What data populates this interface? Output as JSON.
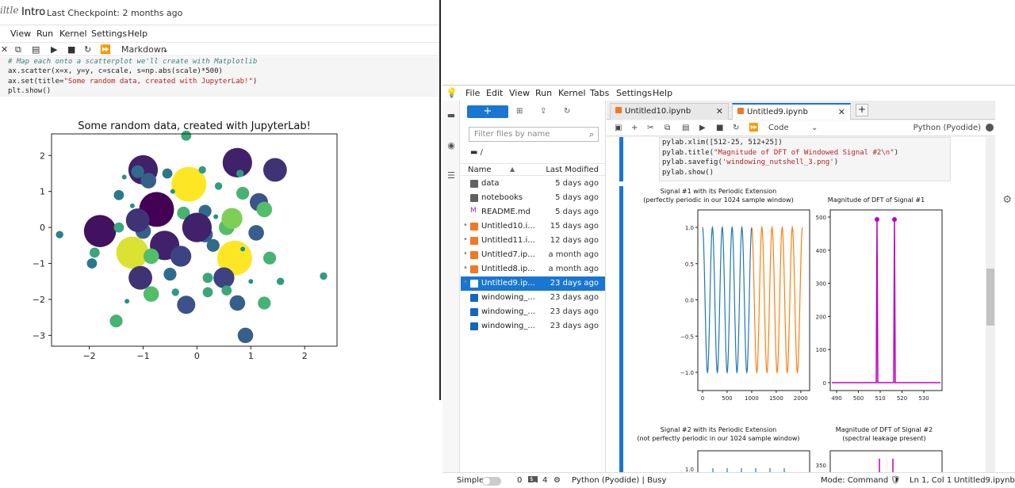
{
  "left_window": {
    "logo": "iltle",
    "notebook_name": "Intro",
    "checkpoint": "Last Checkpoint: 2 months ago",
    "menu": [
      "View",
      "Run",
      "Kernel",
      "Settings",
      "Help"
    ],
    "toolbar": {
      "cell_type": "Markdown"
    },
    "code_lines": {
      "l1": "# Map each onto a scatterplot we'll create with Matplotlib",
      "l2": "ax.scatter(x=x, y=y, c=scale, s=np.abs(scale)*500)",
      "l3a": "ax.set(title=",
      "l3b": "\"Some random data, created with JupyterLab!\"",
      "l3c": ")",
      "l4": "plt.show()"
    },
    "chart_data": {
      "type": "scatter",
      "title": "Some random data, created with JupyterLab!",
      "xlim": [
        -2.7,
        2.6
      ],
      "ylim": [
        -3.3,
        2.6
      ],
      "xticks": [
        -2,
        -1,
        0,
        1,
        2
      ],
      "yticks": [
        -3,
        -2,
        -1,
        0,
        1,
        2
      ],
      "xtick_labels": [
        "−2",
        "−1",
        "0",
        "1",
        "2"
      ],
      "ytick_labels": [
        "−3",
        "−2",
        "−1",
        "0",
        "1",
        "2"
      ],
      "points": [
        {
          "x": -0.2,
          "y": 2.55,
          "c": 0.6
        },
        {
          "x": -1.0,
          "y": 1.6,
          "c": 0.1
        },
        {
          "x": -1.1,
          "y": 1.55,
          "c": 0.35
        },
        {
          "x": -1.35,
          "y": 1.4,
          "c": 0.5
        },
        {
          "x": -0.9,
          "y": 1.3,
          "c": 0.3
        },
        {
          "x": -0.55,
          "y": 1.5,
          "c": 0.4
        },
        {
          "x": -0.15,
          "y": 1.2,
          "c": 1.0
        },
        {
          "x": 0.1,
          "y": 1.6,
          "c": 0.55
        },
        {
          "x": 0.4,
          "y": 1.15,
          "c": 0.55
        },
        {
          "x": 0.75,
          "y": 1.8,
          "c": 0.1
        },
        {
          "x": 0.8,
          "y": 1.5,
          "c": 0.55
        },
        {
          "x": 0.85,
          "y": 0.95,
          "c": 0.65
        },
        {
          "x": 1.45,
          "y": 1.6,
          "c": 0.15
        },
        {
          "x": 1.15,
          "y": 0.7,
          "c": 0.25
        },
        {
          "x": 1.25,
          "y": 0.5,
          "c": 0.7
        },
        {
          "x": -1.45,
          "y": 0.9,
          "c": 0.4
        },
        {
          "x": -1.2,
          "y": 0.6,
          "c": 0.5
        },
        {
          "x": -0.75,
          "y": 0.5,
          "c": 0.0
        },
        {
          "x": -0.45,
          "y": 1.0,
          "c": 0.5
        },
        {
          "x": -0.25,
          "y": 0.4,
          "c": 0.65
        },
        {
          "x": 0.15,
          "y": 0.45,
          "c": 0.35
        },
        {
          "x": 0.35,
          "y": 0.3,
          "c": 0.5
        },
        {
          "x": 0.55,
          "y": 0.0,
          "c": 0.7
        },
        {
          "x": 0.65,
          "y": 0.25,
          "c": 0.8
        },
        {
          "x": -1.8,
          "y": -0.1,
          "c": 0.05
        },
        {
          "x": -1.45,
          "y": 0.0,
          "c": 0.6
        },
        {
          "x": -1.0,
          "y": -0.1,
          "c": 0.3
        },
        {
          "x": -0.6,
          "y": -0.5,
          "c": 0.1
        },
        {
          "x": -1.2,
          "y": -0.7,
          "c": 0.95
        },
        {
          "x": -0.85,
          "y": -0.8,
          "c": 0.7
        },
        {
          "x": -0.3,
          "y": -0.8,
          "c": 0.2
        },
        {
          "x": 0.15,
          "y": -0.2,
          "c": 0.3
        },
        {
          "x": 0.3,
          "y": -0.5,
          "c": 0.35
        },
        {
          "x": 0.7,
          "y": -0.85,
          "c": 1.0
        },
        {
          "x": 0.85,
          "y": -0.6,
          "c": 0.5
        },
        {
          "x": 1.1,
          "y": -0.15,
          "c": 0.3
        },
        {
          "x": 1.35,
          "y": -0.85,
          "c": 0.65
        },
        {
          "x": -1.9,
          "y": -0.7,
          "c": 0.6
        },
        {
          "x": -2.55,
          "y": -0.2,
          "c": 0.45
        },
        {
          "x": -1.05,
          "y": -1.4,
          "c": 0.15
        },
        {
          "x": -0.85,
          "y": -1.85,
          "c": 0.7
        },
        {
          "x": -0.4,
          "y": -1.8,
          "c": 0.55
        },
        {
          "x": 0.2,
          "y": -1.4,
          "c": 0.6
        },
        {
          "x": 0.5,
          "y": -1.4,
          "c": 0.2
        },
        {
          "x": 0.55,
          "y": -1.75,
          "c": 0.6
        },
        {
          "x": 0.2,
          "y": -1.8,
          "c": 0.6
        },
        {
          "x": -0.2,
          "y": -2.15,
          "c": 0.25
        },
        {
          "x": 0.75,
          "y": -2.1,
          "c": 0.3
        },
        {
          "x": 1.25,
          "y": -2.1,
          "c": 0.65
        },
        {
          "x": -1.3,
          "y": -2.05,
          "c": 0.5
        },
        {
          "x": -1.5,
          "y": -2.6,
          "c": 0.65
        },
        {
          "x": 0.9,
          "y": -3.0,
          "c": 0.3
        },
        {
          "x": 2.35,
          "y": -1.35,
          "c": 0.55
        },
        {
          "x": 1.55,
          "y": -1.5,
          "c": 0.55
        },
        {
          "x": -1.95,
          "y": -1.0,
          "c": 0.4
        },
        {
          "x": -0.5,
          "y": -1.3,
          "c": 0.35
        },
        {
          "x": 1.0,
          "y": -1.5,
          "c": 0.5
        },
        {
          "x": -1.1,
          "y": 0.2,
          "c": 0.15
        },
        {
          "x": 0.0,
          "y": 0.0,
          "c": 0.1
        }
      ]
    }
  },
  "right_window": {
    "menu": [
      "File",
      "Edit",
      "View",
      "Run",
      "Kernel",
      "Tabs",
      "Settings",
      "Help"
    ],
    "file_browser": {
      "new_label": "+",
      "filter_placeholder": "Filter files by name",
      "breadcrumb": "/",
      "col_name": "Name",
      "col_modified": "Last Modified",
      "files": [
        {
          "name": "data",
          "modified": "5 days ago",
          "kind": "folder",
          "running": false,
          "selected": false
        },
        {
          "name": "notebooks",
          "modified": "5 days ago",
          "kind": "folder",
          "running": false,
          "selected": false
        },
        {
          "name": "README.md",
          "modified": "5 days ago",
          "kind": "markdown",
          "running": false,
          "selected": false
        },
        {
          "name": "Untitled10.i...",
          "modified": "15 days ago",
          "kind": "notebook",
          "running": true,
          "selected": false
        },
        {
          "name": "Untitled11.i...",
          "modified": "12 days ago",
          "kind": "notebook",
          "running": true,
          "selected": false
        },
        {
          "name": "Untitled7.ip...",
          "modified": "a month ago",
          "kind": "notebook",
          "running": true,
          "selected": false
        },
        {
          "name": "Untitled8.ip...",
          "modified": "a month ago",
          "kind": "notebook",
          "running": true,
          "selected": false
        },
        {
          "name": "Untitled9.ip...",
          "modified": "23 days ago",
          "kind": "notebook",
          "running": true,
          "selected": true
        },
        {
          "name": "windowing_...",
          "modified": "23 days ago",
          "kind": "image",
          "running": false,
          "selected": false
        },
        {
          "name": "windowing_...",
          "modified": "23 days ago",
          "kind": "image",
          "running": false,
          "selected": false
        },
        {
          "name": "windowing_...",
          "modified": "23 days ago",
          "kind": "image",
          "running": false,
          "selected": false
        }
      ]
    },
    "tabs": [
      {
        "label": "Untitled10.ipynb",
        "active": false
      },
      {
        "label": "Untitled9.ipynb",
        "active": true
      }
    ],
    "toolbar": {
      "cell_type": "Code",
      "kernel": "Python (Pyodide)"
    },
    "code": {
      "l1": "pylab.xlim([512-25, 512+25])",
      "l2a": "pylab.title(",
      "l2b": "\"Magnitude of DFT of Windowed Signal #2\\n\"",
      "l2c": ")",
      "l3a": "pylab.savefig(",
      "l3b": "'windowing_nutshell_3.png'",
      "l3c": ")",
      "l4": "pylab.show()"
    },
    "fig1": {
      "left_title_1": "Signal #1 with its Periodic Extension",
      "left_title_2": "(perfectly periodic in our 1024 sample window)",
      "right_title": "Magnitude of DFT of Signal #1",
      "left_yticks": [
        "1.0",
        "0.5",
        "0.0",
        "−0.5",
        "−1.0"
      ],
      "left_xticks": [
        "0",
        "500",
        "1000",
        "1500",
        "2000"
      ],
      "right_yticks": [
        "500",
        "400",
        "300",
        "200",
        "100",
        "0"
      ],
      "right_xticks": [
        "490",
        "500",
        "510",
        "520",
        "530"
      ],
      "signal_color_1": "#1f77b4",
      "signal_color_2": "#ff7f0e",
      "dft_color": "#bf00bf"
    },
    "fig2": {
      "left_title_1": "Signal #2 with its Periodic Extension",
      "left_title_2": "(not perfectly periodic in our 1024 sample window)",
      "right_title_1": "Magnitude of DFT of Signal #2",
      "right_title_2": "(spectral leakage present)",
      "left_ytick": "1.0",
      "right_ytick": "350"
    },
    "status": {
      "mode_simple": "Simple",
      "count_a": "0",
      "count_b": "4",
      "kernel": "Python (Pyodide) | Busy",
      "mode": "Mode: Command",
      "position": "Ln 1, Col 1",
      "file": "Untitled9.ipynb"
    }
  }
}
